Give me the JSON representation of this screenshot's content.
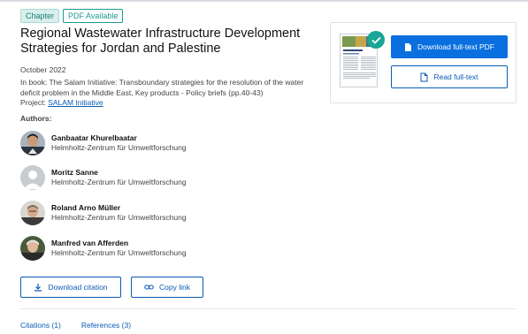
{
  "badges": {
    "chapter": "Chapter",
    "pdf": "PDF Available"
  },
  "title": "Regional Wastewater Infrastructure Development Strategies for Jordan and Palestine",
  "date": "October 2022",
  "in_book": "In book: The Salam Initiative: Transboundary strategies for the resolution of the water deficit problem in the Middle East, Key products - Policy briefs (pp.40-43)",
  "project": {
    "label": "Project:",
    "link": "SALAM Initiative"
  },
  "authors_heading": "Authors:",
  "authors": [
    {
      "name": "Ganbaatar Khurelbaatar",
      "institution": "Helmholtz-Zentrum für Umweltforschung"
    },
    {
      "name": "Moritz Sanne",
      "institution": "Helmholtz-Zentrum für Umweltforschung"
    },
    {
      "name": "Roland Arno Müller",
      "institution": "Helmholtz-Zentrum für Umweltforschung"
    },
    {
      "name": "Manfred van Afferden",
      "institution": "Helmholtz-Zentrum für Umweltforschung"
    }
  ],
  "actions": {
    "download_citation": "Download citation",
    "copy_link": "Copy link"
  },
  "side": {
    "download_pdf": "Download full-text PDF",
    "read_full": "Read full-text"
  },
  "tabs": {
    "citations": "Citations (1)",
    "references": "References (3)"
  },
  "colors": {
    "accent": "#0a70e0",
    "link": "#0a5bb5",
    "teal": "#1a9b8e"
  }
}
